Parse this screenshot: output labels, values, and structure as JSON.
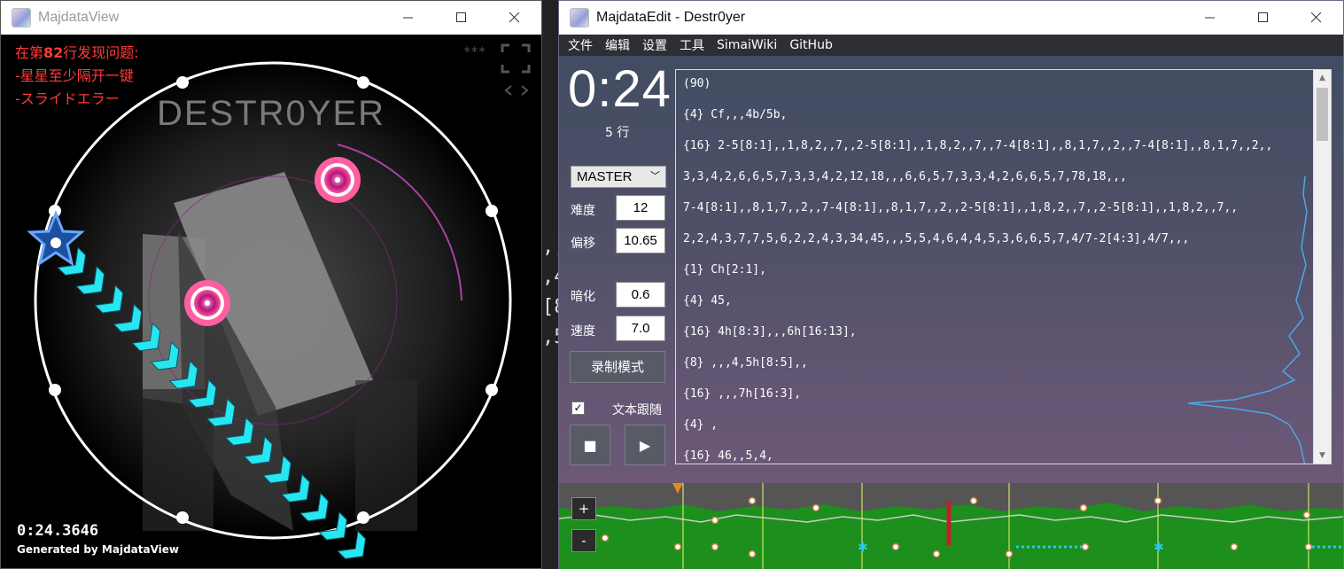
{
  "desktop": {
    "partial_code": [
      ",,",
      ",4",
      "[8",
      ",5"
    ]
  },
  "view_window": {
    "title": "MajdataView",
    "error": {
      "prefix": "在第",
      "line": "82",
      "suffix": "行发现问题:",
      "items": [
        "-星星至少隔开一键",
        "-スライドエラー"
      ]
    },
    "hud": "***",
    "time": "0:24.3646",
    "generated": "Generated by MajdataView",
    "logo": "DESTR0YER"
  },
  "edit_window": {
    "title": "MajdataEdit - Destr0yer",
    "menu": [
      "文件",
      "编辑",
      "设置",
      "工具",
      "SimaiWiki",
      "GitHub"
    ],
    "clock": "0:24",
    "line_info": "5 行",
    "difficulty_select": "MASTER",
    "fields": [
      {
        "label": "难度",
        "value": "12"
      },
      {
        "label": "偏移",
        "value": "10.65"
      },
      {
        "label": "暗化",
        "value": "0.6"
      },
      {
        "label": "速度",
        "value": "7.0"
      }
    ],
    "record_button": "录制模式",
    "follow_checkbox": {
      "label": "文本跟随",
      "checked": "✓"
    },
    "stop_icon": "■",
    "play_icon": "▶",
    "code_lines": [
      "(90)",
      "{4} Cf,,,4b/5b,",
      "{16} 2-5[8:1],,1,8,2,,7,,2-5[8:1],,1,8,2,,7,,7-4[8:1],,8,1,7,,2,,7-4[8:1],,8,1,7,,2,,",
      "3,3,4,2,6,6,5,7,3,3,4,2,12,18,,,6,6,5,7,3,3,4,2,6,6,5,7,78,18,,,",
      "7-4[8:1],,8,1,7,,2,,7-4[8:1],,8,1,7,,2,,2-5[8:1],,1,8,2,,7,,2-5[8:1],,1,8,2,,7,,",
      "2,2,4,3,7,7,5,6,2,2,4,3,34,45,,,5,5,4,6,4,4,5,3,6,6,5,7,4/7-2[4:3],4/7,,,",
      "{1} Ch[2:1],",
      "{4} 45,",
      "{16} 4h[8:3],,,6h[16:13],",
      "{8} ,,,4,5h[8:5],,",
      "{16} ,,,7h[16:3],",
      "{4} ,",
      "{16} 46,,5,4,"
    ],
    "timeline": {
      "zoom_in": "+",
      "zoom_out": "-"
    }
  },
  "colors": {
    "error": "#ff3a3a",
    "slide": "#28e6f0",
    "tap": "#ff5fa0",
    "timeline_bg": "#1d8f1d"
  }
}
